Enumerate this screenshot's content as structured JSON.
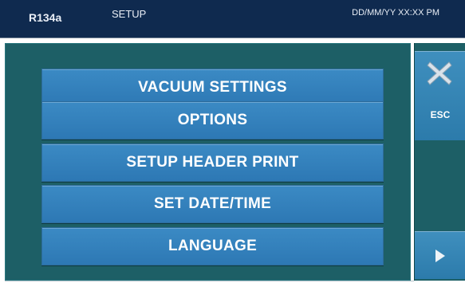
{
  "header": {
    "product": "R134a",
    "title": "SETUP",
    "datetime": "DD/MM/YY XX:XX PM"
  },
  "menu": {
    "items": [
      {
        "label": "VACUUM SETTINGS"
      },
      {
        "label": "OPTIONS"
      },
      {
        "label": "SETUP HEADER PRINT"
      },
      {
        "label": "SET DATE/TIME"
      },
      {
        "label": "LANGUAGE"
      }
    ]
  },
  "sidebar": {
    "esc_label": "ESC",
    "esc_icon": "close-icon",
    "next_icon": "play-arrow-icon"
  },
  "colors": {
    "header_bg": "#0f2a4f",
    "panel_bg": "#1d5f66",
    "button_bg": "#2d78b4",
    "text": "#ffffff"
  }
}
